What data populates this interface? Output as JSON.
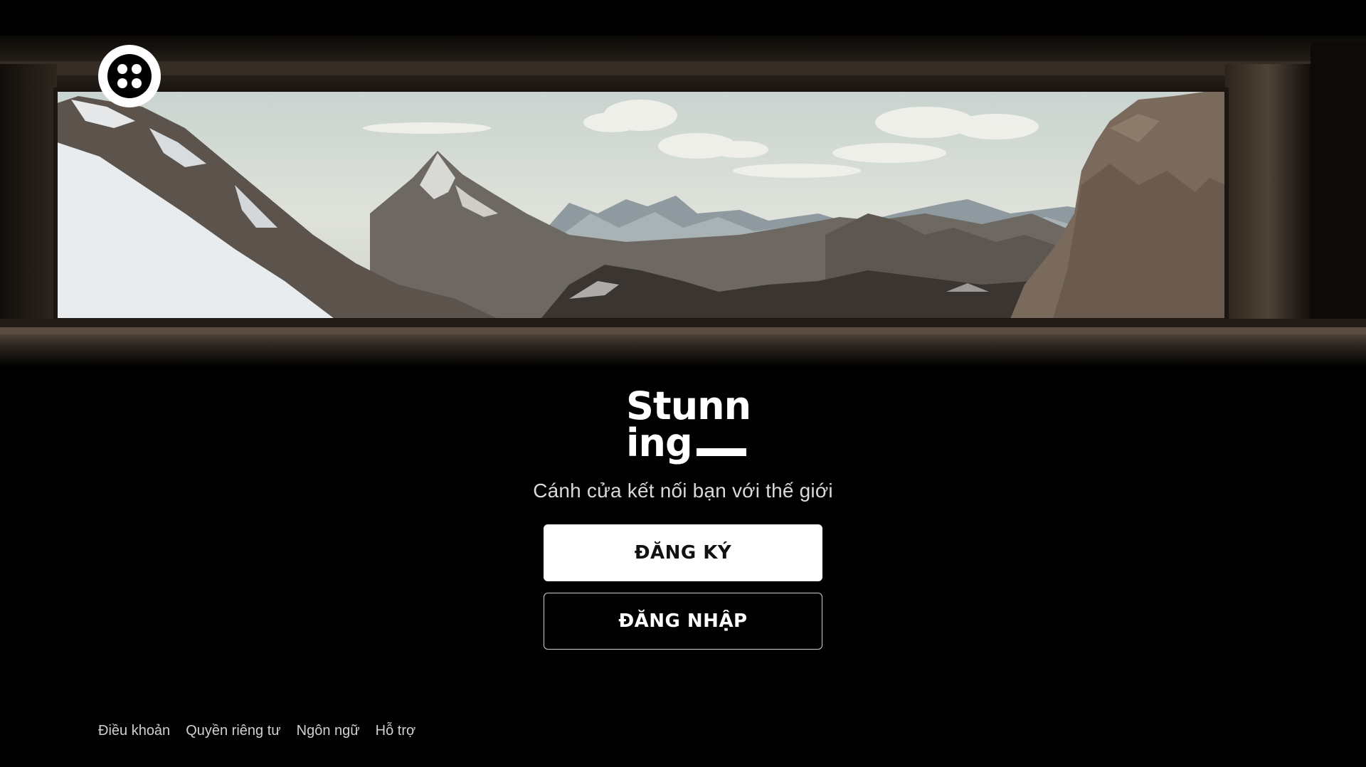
{
  "brand": {
    "logo_icon": "dots-circle-logo-icon",
    "wordmark_line1": "Stunn",
    "wordmark_line2": "ing"
  },
  "tagline": "Cánh cửa kết nối bạn với thế giới",
  "buttons": {
    "signup_label": "ĐĂNG KÝ",
    "login_label": "ĐĂNG NHẬP"
  },
  "footer": {
    "links": [
      "Điều khoản",
      "Quyền riêng tư",
      "Ngôn ngữ",
      "Hỗ trợ"
    ]
  },
  "colors": {
    "background": "#000000",
    "primary_button": "#ffffff",
    "text": "#ffffff"
  }
}
